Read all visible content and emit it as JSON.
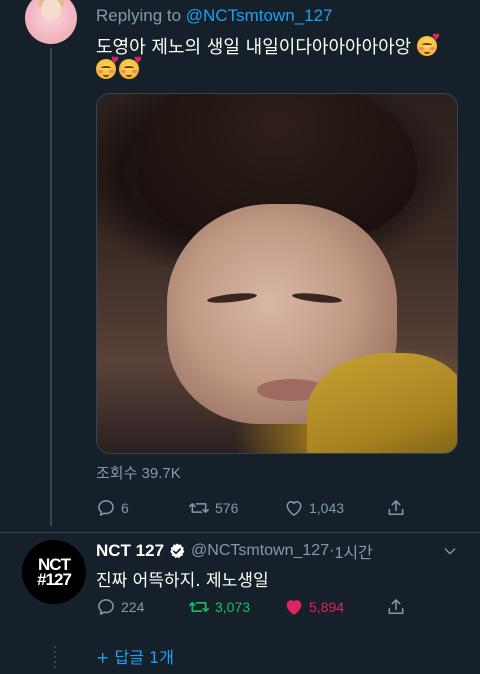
{
  "tweet1": {
    "replying_prefix": "Replying to ",
    "replying_handle": "@NCTsmtown_127",
    "text": "도영아 제노의 생일 내일이다아아아아아앙",
    "avatar_caption": "",
    "views": "조회수 39.7K",
    "actions": {
      "reply_count": "6",
      "retweet_count": "576",
      "like_count": "1,043"
    }
  },
  "tweet2": {
    "name": "NCT 127",
    "handle": "@NCTsmtown_127",
    "separator": " · ",
    "time": "1시간",
    "text": "진짜 어뜩하지. 제노생일",
    "avatar_logo_line1": "NCT",
    "avatar_logo_line2": "#127",
    "actions": {
      "reply_count": "224",
      "retweet_count": "3,073",
      "like_count": "5,894"
    }
  },
  "more_replies": "+ 답글 1개",
  "colors": {
    "background": "#15202b",
    "accent": "#1da1f2",
    "muted": "#8899a6",
    "retweet_green": "#17bf63",
    "like_pink": "#e0245e"
  },
  "icons": {
    "reply": "reply-icon",
    "retweet": "retweet-icon",
    "like": "heart-icon",
    "share": "share-icon",
    "verified": "verified-badge-icon",
    "chevron": "chevron-down-icon"
  }
}
